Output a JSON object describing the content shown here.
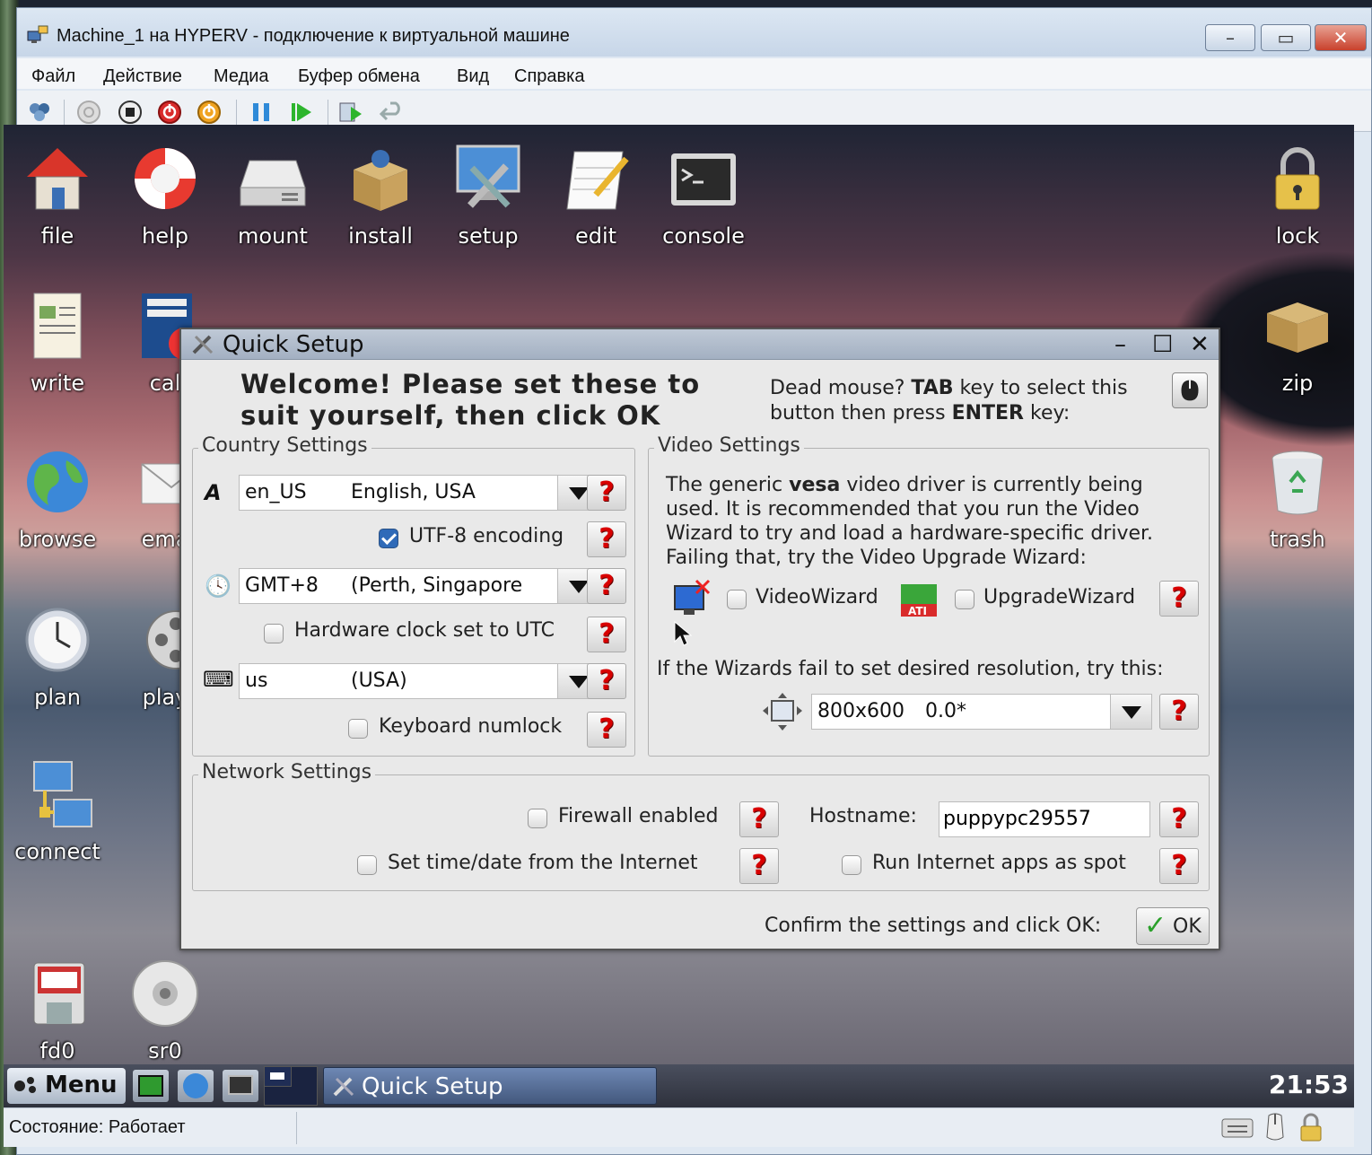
{
  "host": {
    "title": "Machine_1 на HYPERV - подключение к виртуальной машине",
    "menu": [
      "Файл",
      "Действие",
      "Медиа",
      "Буфер обмена",
      "Вид",
      "Справка"
    ],
    "status": "Состояние: Работает"
  },
  "desktop": {
    "icons_top": [
      "file",
      "help",
      "mount",
      "install",
      "setup",
      "edit",
      "console"
    ],
    "icon_lock": "lock",
    "icons_left": [
      "write",
      "cal",
      "browse",
      "ema",
      "plan",
      "play",
      "connect",
      "fd0",
      "sr0"
    ],
    "icon_zip": "zip",
    "icon_trash": "trash"
  },
  "dialog": {
    "title": "Quick Setup",
    "welcome_line1": "Welcome! Please set these to",
    "welcome_line2": "suit yourself, then click OK",
    "dead_mouse_1a": "Dead mouse? ",
    "dead_mouse_1b": "TAB",
    "dead_mouse_1c": " key to select this",
    "dead_mouse_2a": "button then press ",
    "dead_mouse_2b": "ENTER",
    "dead_mouse_2c": " key:",
    "country": {
      "legend": "Country Settings",
      "locale_code": "en_US",
      "locale_name": "English, USA",
      "utf8_label": "UTF-8 encoding",
      "utf8_checked": true,
      "tz_code": "GMT+8",
      "tz_name": "(Perth, Singapore",
      "hwclock_label": "Hardware clock set to UTC",
      "kbd_code": "us",
      "kbd_name": "(USA)",
      "numlock_label": "Keyboard numlock"
    },
    "video": {
      "legend": "Video Settings",
      "p1a": "The generic ",
      "p1b": "vesa",
      "p1c": " video driver is currently being",
      "p2": "used. It is recommended that you run the Video",
      "p3": "Wizard to try and load a hardware-specific driver.",
      "p4": "Failing that, try the Video Upgrade Wizard:",
      "videowizard": "VideoWizard",
      "upgradewizard": "UpgradeWizard",
      "fallback": "If the Wizards fail to set desired resolution, try this:",
      "res_size": "800x600",
      "res_rate": "0.0*"
    },
    "network": {
      "legend": "Network Settings",
      "firewall": "Firewall enabled",
      "hostname_label": "Hostname:",
      "hostname_value": "puppypc29557",
      "timedate": "Set time/date from the Internet",
      "spot": "Run Internet apps as spot"
    },
    "confirm": "Confirm the settings and click OK:",
    "ok": "OK",
    "help_glyph": "?"
  },
  "taskbar": {
    "menu": "Menu",
    "task": "Quick Setup",
    "clock": "21:53"
  }
}
